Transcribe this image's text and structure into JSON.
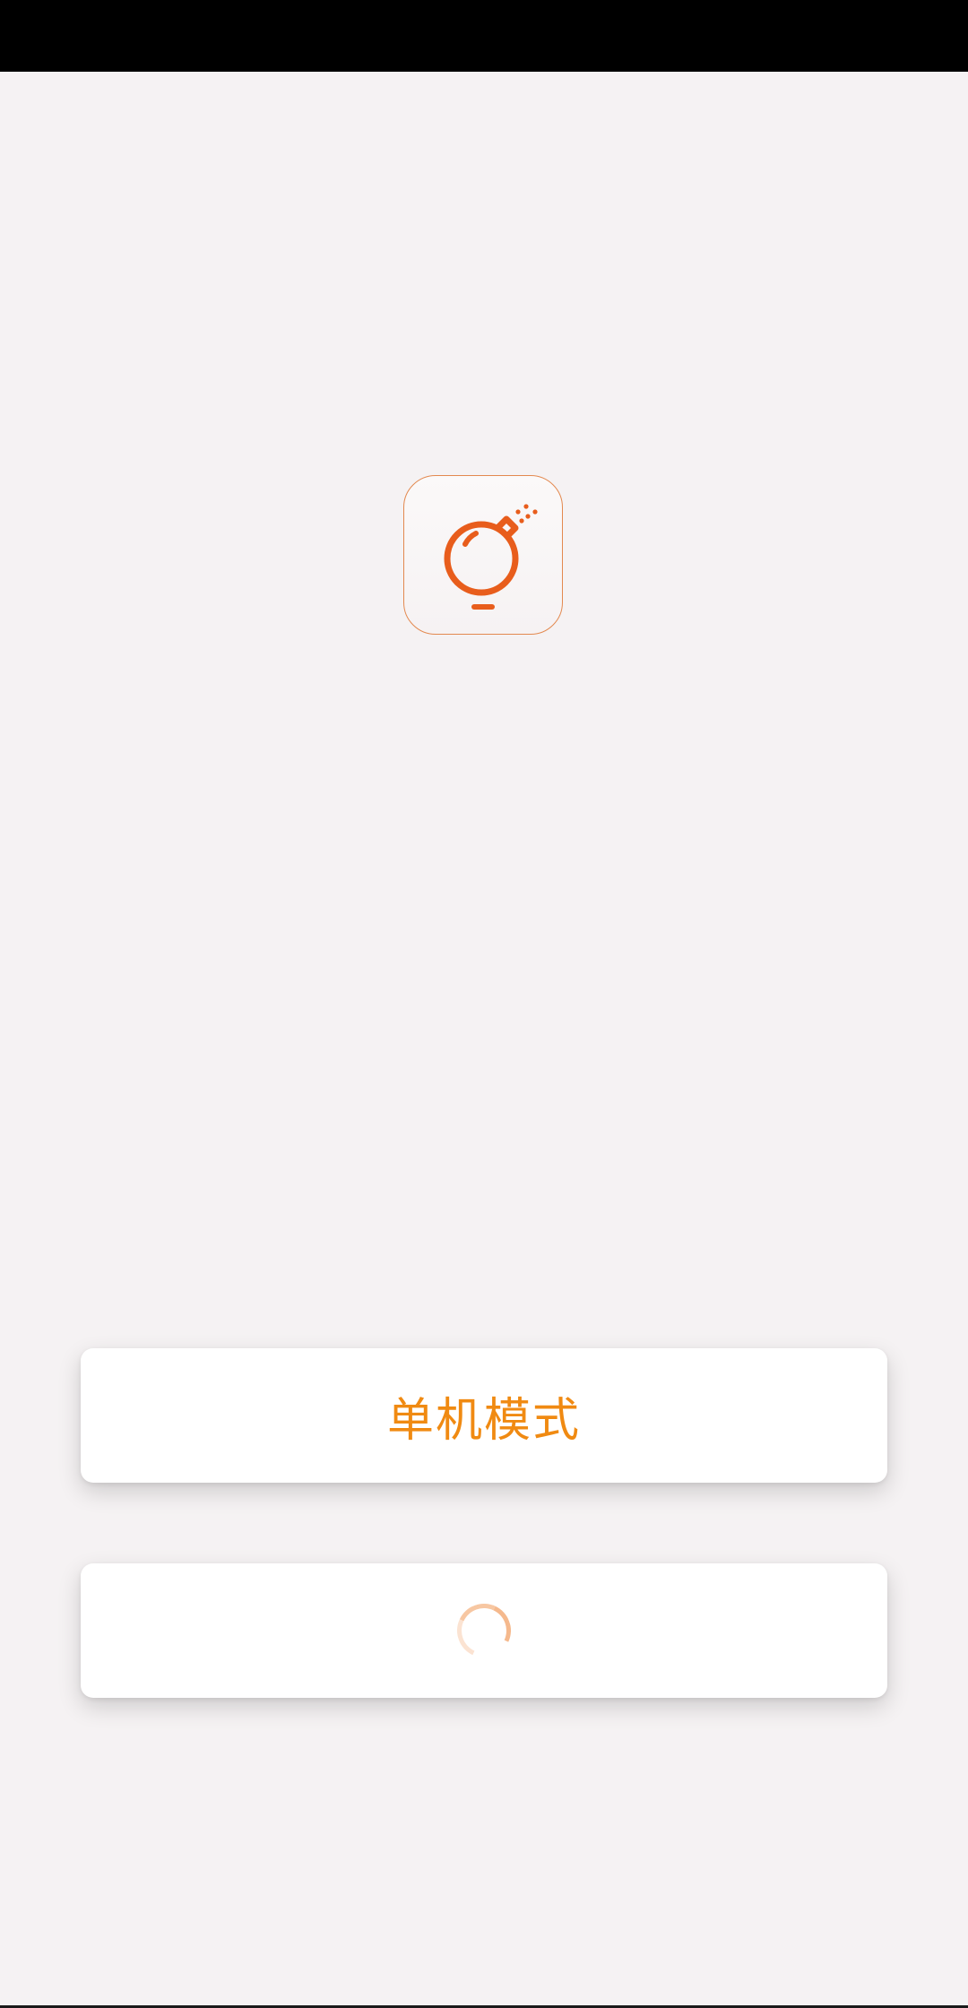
{
  "buttons": {
    "standalone_label": "单机模式"
  },
  "icons": {
    "app": "bomb-icon",
    "loading": "loading-spinner-icon"
  },
  "colors": {
    "accent": "#f08a12",
    "icon_stroke": "#e85d1c",
    "background": "#f5f2f3",
    "status_bar": "#000000"
  }
}
